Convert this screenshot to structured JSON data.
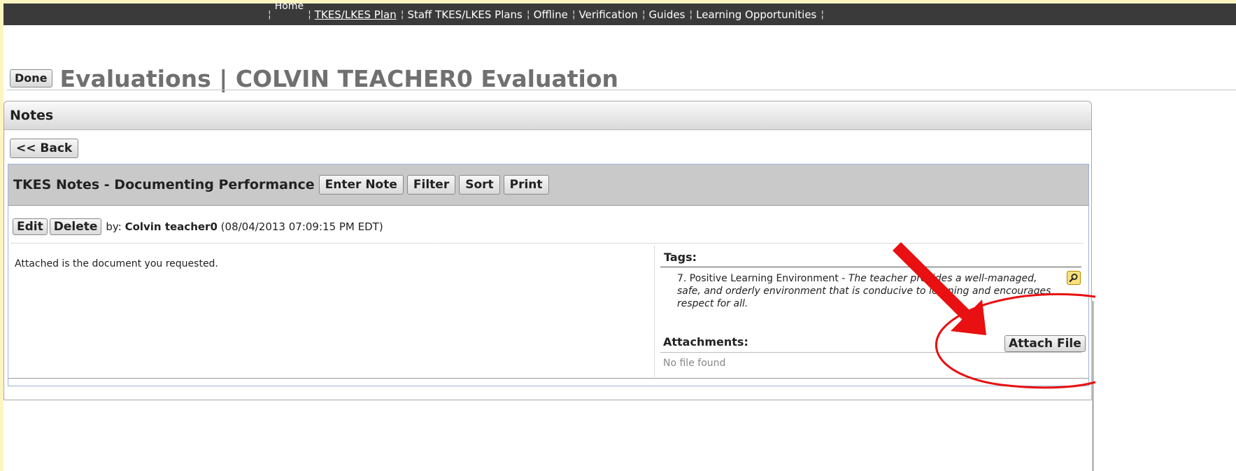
{
  "nav": {
    "items": [
      {
        "label": "Home",
        "partial": true
      },
      {
        "label": "TKES/LKES Plan",
        "active": true
      },
      {
        "label": "Staff TKES/LKES Plans"
      },
      {
        "label": "Offline"
      },
      {
        "label": "Verification"
      },
      {
        "label": "Guides"
      },
      {
        "label": "Learning Opportunities"
      }
    ]
  },
  "header": {
    "done_label": "Done",
    "title": "Evaluations | COLVIN TEACHER0 Evaluation"
  },
  "notes": {
    "heading": "Notes",
    "back_label": "<< Back",
    "section_title": "TKES Notes - Documenting Performance",
    "toolbar": {
      "enter_note": "Enter Note",
      "filter": "Filter",
      "sort": "Sort",
      "print": "Print"
    },
    "note": {
      "edit_label": "Edit",
      "delete_label": "Delete",
      "by_prefix": "by:",
      "author": "Colvin teacher0",
      "timestamp": "(08/04/2013 07:09:15 PM EDT)",
      "body": "Attached is the document you requested.",
      "tags_label": "Tags:",
      "tag_name": "7. Positive Learning Environment",
      "tag_separator": " - ",
      "tag_description": "The teacher provides a well-managed, safe, and orderly environment that is conducive to learning and encourages respect for all.",
      "attachments_label": "Attachments:",
      "attach_button": "Attach File",
      "no_file_text": "No file found"
    }
  },
  "icons": {
    "tag_search": "magnifier-icon"
  },
  "colors": {
    "nav_bg": "#3a3a3a",
    "frame": "#fdf5c0",
    "title_gray": "#707070",
    "annotation_red": "#e81010",
    "tag_icon_bg": "#f8e07a"
  }
}
